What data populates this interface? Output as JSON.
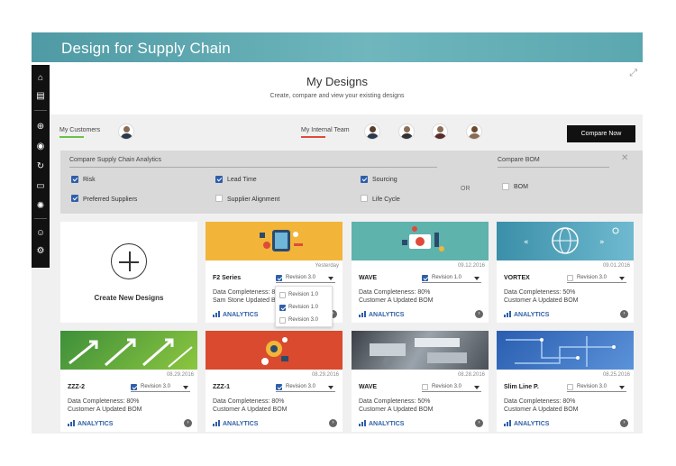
{
  "app": {
    "title": "Design for Supply Chain"
  },
  "header": {
    "title": "My Designs",
    "subtitle": "Create, compare and view your existing designs"
  },
  "team": {
    "customers_label": "My Customers",
    "internal_label": "My Internal Team",
    "compare_label": "Compare Now"
  },
  "analytics": {
    "title": "Compare Supply Chain Analytics",
    "options": [
      {
        "label": "Risk",
        "checked": true
      },
      {
        "label": "Lead Time",
        "checked": true
      },
      {
        "label": "Sourcing",
        "checked": true
      },
      {
        "label": "Preferred Suppliers",
        "checked": true
      },
      {
        "label": "Supplier Alignment",
        "checked": false
      },
      {
        "label": "Life Cycle",
        "checked": false
      }
    ],
    "or_label": "OR",
    "bom_title": "Compare BOM",
    "bom_option": {
      "label": "BOM",
      "checked": false
    }
  },
  "create": {
    "label": "Create New Designs"
  },
  "dropdown": {
    "options": [
      {
        "label": "Revision 1.0",
        "checked": false
      },
      {
        "label": "Revision 1.0",
        "checked": true
      },
      {
        "label": "Revision 3.0",
        "checked": false
      }
    ]
  },
  "cards": [
    {
      "name": "F2 Series",
      "date": "Yesterday",
      "revision": "Revision 3.0",
      "checked": true,
      "line1": "Data Completeness: 80%",
      "line2": "Sam Stone Updated BOM",
      "analytics": "ANALYTICS",
      "image": "yellow-tech"
    },
    {
      "name": "WAVE",
      "date": "09.12.2016",
      "revision": "Revision 1.0",
      "checked": true,
      "line1": "Data Completeness: 80%",
      "line2": "Customer A Updated BOM",
      "analytics": "ANALYTICS",
      "image": "teal-tech"
    },
    {
      "name": "VORTEX",
      "date": "09.01.2016",
      "revision": "Revision 3.0",
      "checked": false,
      "line1": "Data Completeness: 50%",
      "line2": "Customer A Updated BOM",
      "analytics": "ANALYTICS",
      "image": "blue-globe"
    },
    {
      "name": "ZZZ-2",
      "date": "08.29.2016",
      "revision": "Revision 3.0",
      "checked": true,
      "line1": "Data Completeness: 80%",
      "line2": "Customer A Updated BOM",
      "analytics": "ANALYTICS",
      "image": "green-arrows"
    },
    {
      "name": "ZZZ-1",
      "date": "08.29.2016",
      "revision": "Revision 3.0",
      "checked": true,
      "line1": "Data Completeness: 80%",
      "line2": "Customer A Updated BOM",
      "analytics": "ANALYTICS",
      "image": "red-tech"
    },
    {
      "name": "WAVE",
      "date": "08.28.2016",
      "revision": "Revision 3.0",
      "checked": false,
      "line1": "Data Completeness: 50%",
      "line2": "Customer A Updated BOM",
      "analytics": "ANALYTICS",
      "image": "metal-parts"
    },
    {
      "name": "Slim Line P.",
      "date": "08.25.2016",
      "revision": "Revision 3.0",
      "checked": false,
      "line1": "Data Completeness: 80%",
      "line2": "Customer A Updated BOM",
      "analytics": "ANALYTICS",
      "image": "circuit-board"
    }
  ],
  "sidebar": {
    "icons": [
      "home-icon",
      "dashboard-icon",
      "globe-icon",
      "chat-icon",
      "refresh-icon",
      "monitor-icon",
      "gear-alt-icon",
      "user-icon",
      "settings-icon"
    ]
  }
}
